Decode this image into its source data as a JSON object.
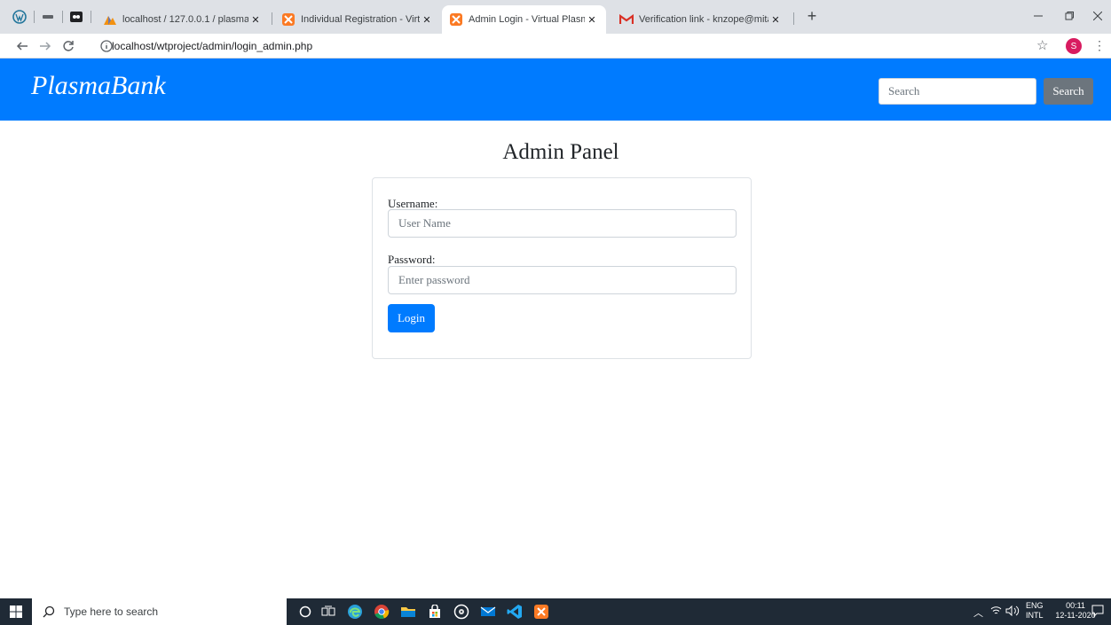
{
  "browser": {
    "tabs": [
      {
        "title": "localhost / 127.0.0.1 / plasmaban",
        "close": "✕"
      },
      {
        "title": "Individual Registration - Virtual P",
        "close": "✕"
      },
      {
        "title": "Admin Login - Virtual Plasma Ba",
        "close": "✕"
      },
      {
        "title": "Verification link - knzope@mitao",
        "close": "✕"
      }
    ],
    "new_tab": "+",
    "url": "localhost/wtproject/admin/login_admin.php",
    "profile_initial": "S"
  },
  "navbar": {
    "brand": "PlasmaBank",
    "search_placeholder": "Search",
    "search_button": "Search",
    "accent_color": "#007bff"
  },
  "main": {
    "heading": "Admin Panel",
    "username_label": "Username:",
    "username_placeholder": "User Name",
    "password_label": "Password:",
    "password_placeholder": "Enter password",
    "login_button": "Login"
  },
  "taskbar": {
    "search_placeholder": "Type here to search",
    "lang_top": "ENG",
    "lang_bottom": "INTL",
    "time": "00:11",
    "date": "12-11-2020"
  }
}
